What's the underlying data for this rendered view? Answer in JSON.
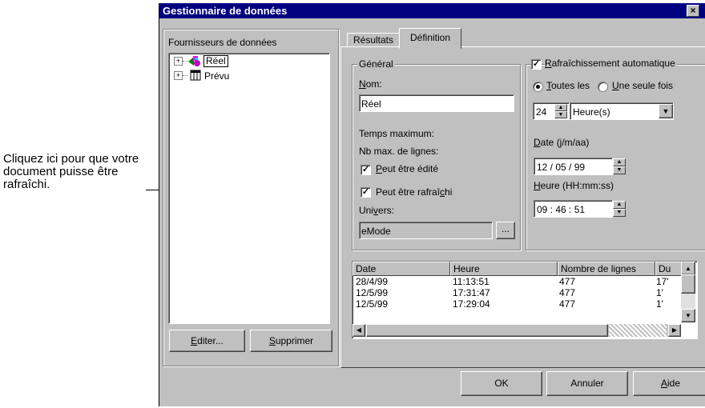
{
  "callout": {
    "text": "Cliquez ici pour que votre document puisse être rafraîchi."
  },
  "window": {
    "title": "Gestionnaire de données",
    "close_glyph": "×"
  },
  "left_panel": {
    "label": "Fournisseurs de données",
    "tree": [
      {
        "label": "Réel",
        "icon": "query-icon"
      },
      {
        "label": "Prévu",
        "icon": "table-icon"
      }
    ],
    "edit_button": "Editer...",
    "delete_button": "Supprimer"
  },
  "tabs": [
    {
      "label": "Résultats"
    },
    {
      "label": "Définition",
      "active": true
    }
  ],
  "general": {
    "legend": "Général",
    "name_label": "Nom:",
    "name_value": "Réel",
    "max_time_label": "Temps maximum:",
    "max_rows_label": "Nb max. de lignes:",
    "editable_label": "Peut être édité",
    "refreshable_label": "Peut être rafraîchi",
    "universe_label": "Univers:",
    "universe_value": "eMode",
    "browse_label": "..."
  },
  "refresh": {
    "auto_label": "Rafraîchissement automatique",
    "every_label": "Toutes les",
    "once_label": "Une seule fois",
    "interval_value": "24",
    "unit_value": "Heure(s)",
    "date_label": "Date (j/m/aa)",
    "date_value": "12 / 05 / 99",
    "time_label": "Heure (HH:mm:ss)",
    "time_value": "09 : 46 : 51"
  },
  "history": {
    "columns": [
      "Date",
      "Heure",
      "Nombre de lignes",
      "Du"
    ],
    "rows": [
      [
        "28/4/99",
        "11:13:51",
        "477",
        "17'"
      ],
      [
        "12/5/99",
        "17:31:47",
        "477",
        "1'"
      ],
      [
        "12/5/99",
        "17:29:04",
        "477",
        "1'"
      ]
    ]
  },
  "footer": {
    "ok": "OK",
    "cancel": "Annuler",
    "help": "Aide"
  }
}
